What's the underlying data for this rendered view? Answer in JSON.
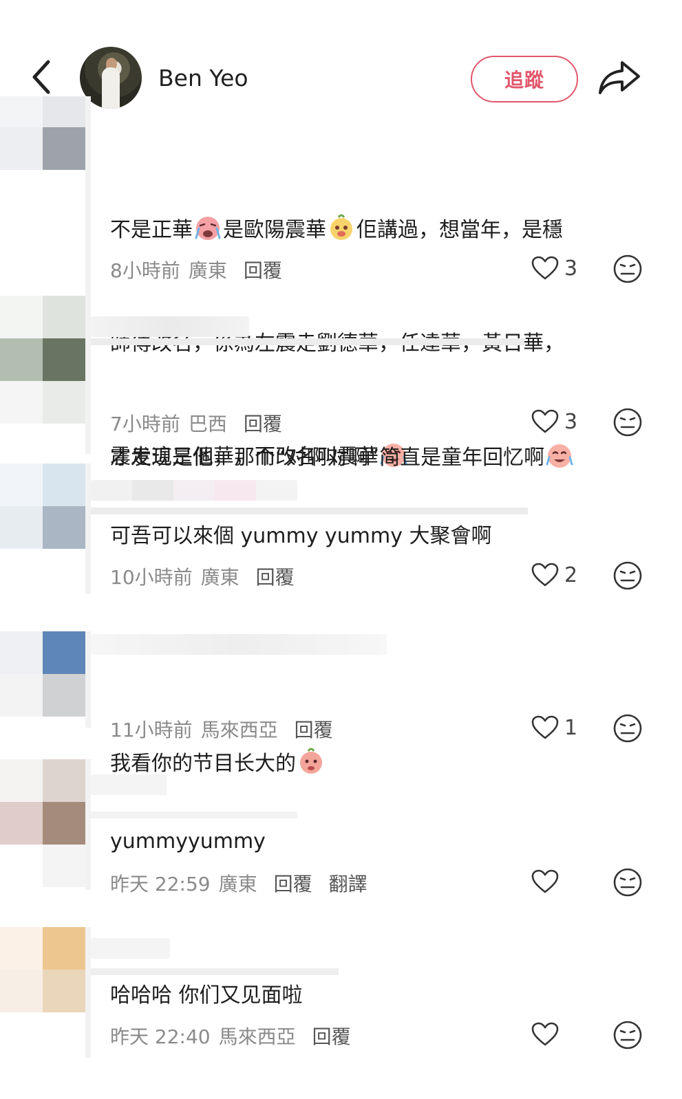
{
  "header": {
    "username": "Ben Yeo",
    "follow_label": "追蹤"
  },
  "icons": {
    "back": "chevron-left-icon",
    "share": "share-arrow-icon",
    "like": "heart-icon",
    "dislike": "dislike-face-icon"
  },
  "colors": {
    "accent": "#e1566b",
    "meta_text": "#8a8a8a"
  },
  "comments": [
    {
      "text_parts": [
        "不是正華",
        "是歐陽震華",
        "佢講過，想當年，是穩師傅改名，係為左震走劉德華，任達華，黃日華，震走這三個華，而改名叫震華"
      ],
      "text_line1a": "不是正華",
      "text_line1b": "是歐陽震華",
      "text_line1c": "佢講過，想當年，是穩",
      "text_line2": "師傅改名，係為左震走劉德華，任達華，黃日華，",
      "text_line3": "震走這三個華，而改名叫震華",
      "time": "8小時前",
      "location": "廣東",
      "reply": "回覆",
      "likes": "3"
    },
    {
      "text": "才发现是他，那个“对啊对啊”简直是童年回忆啊",
      "time": "7小時前",
      "location": "巴西",
      "reply": "回覆",
      "likes": "3"
    },
    {
      "text": "可吾可以來個 yummy yummy 大聚會啊",
      "time": "10小時前",
      "location": "廣東",
      "reply": "回覆",
      "likes": "2"
    },
    {
      "text": "我看你的节目长大的",
      "time": "11小時前",
      "location": "馬來西亞",
      "reply": "回覆",
      "likes": "1"
    },
    {
      "text": "yummyyummy",
      "time": "昨天 22:59",
      "location": "廣東",
      "reply": "回覆",
      "translate": "翻譯",
      "likes": ""
    },
    {
      "text": "哈哈哈 你们又见面啦",
      "time": "昨天 22:40",
      "location": "馬來西亞",
      "reply": "回覆",
      "likes": ""
    }
  ]
}
